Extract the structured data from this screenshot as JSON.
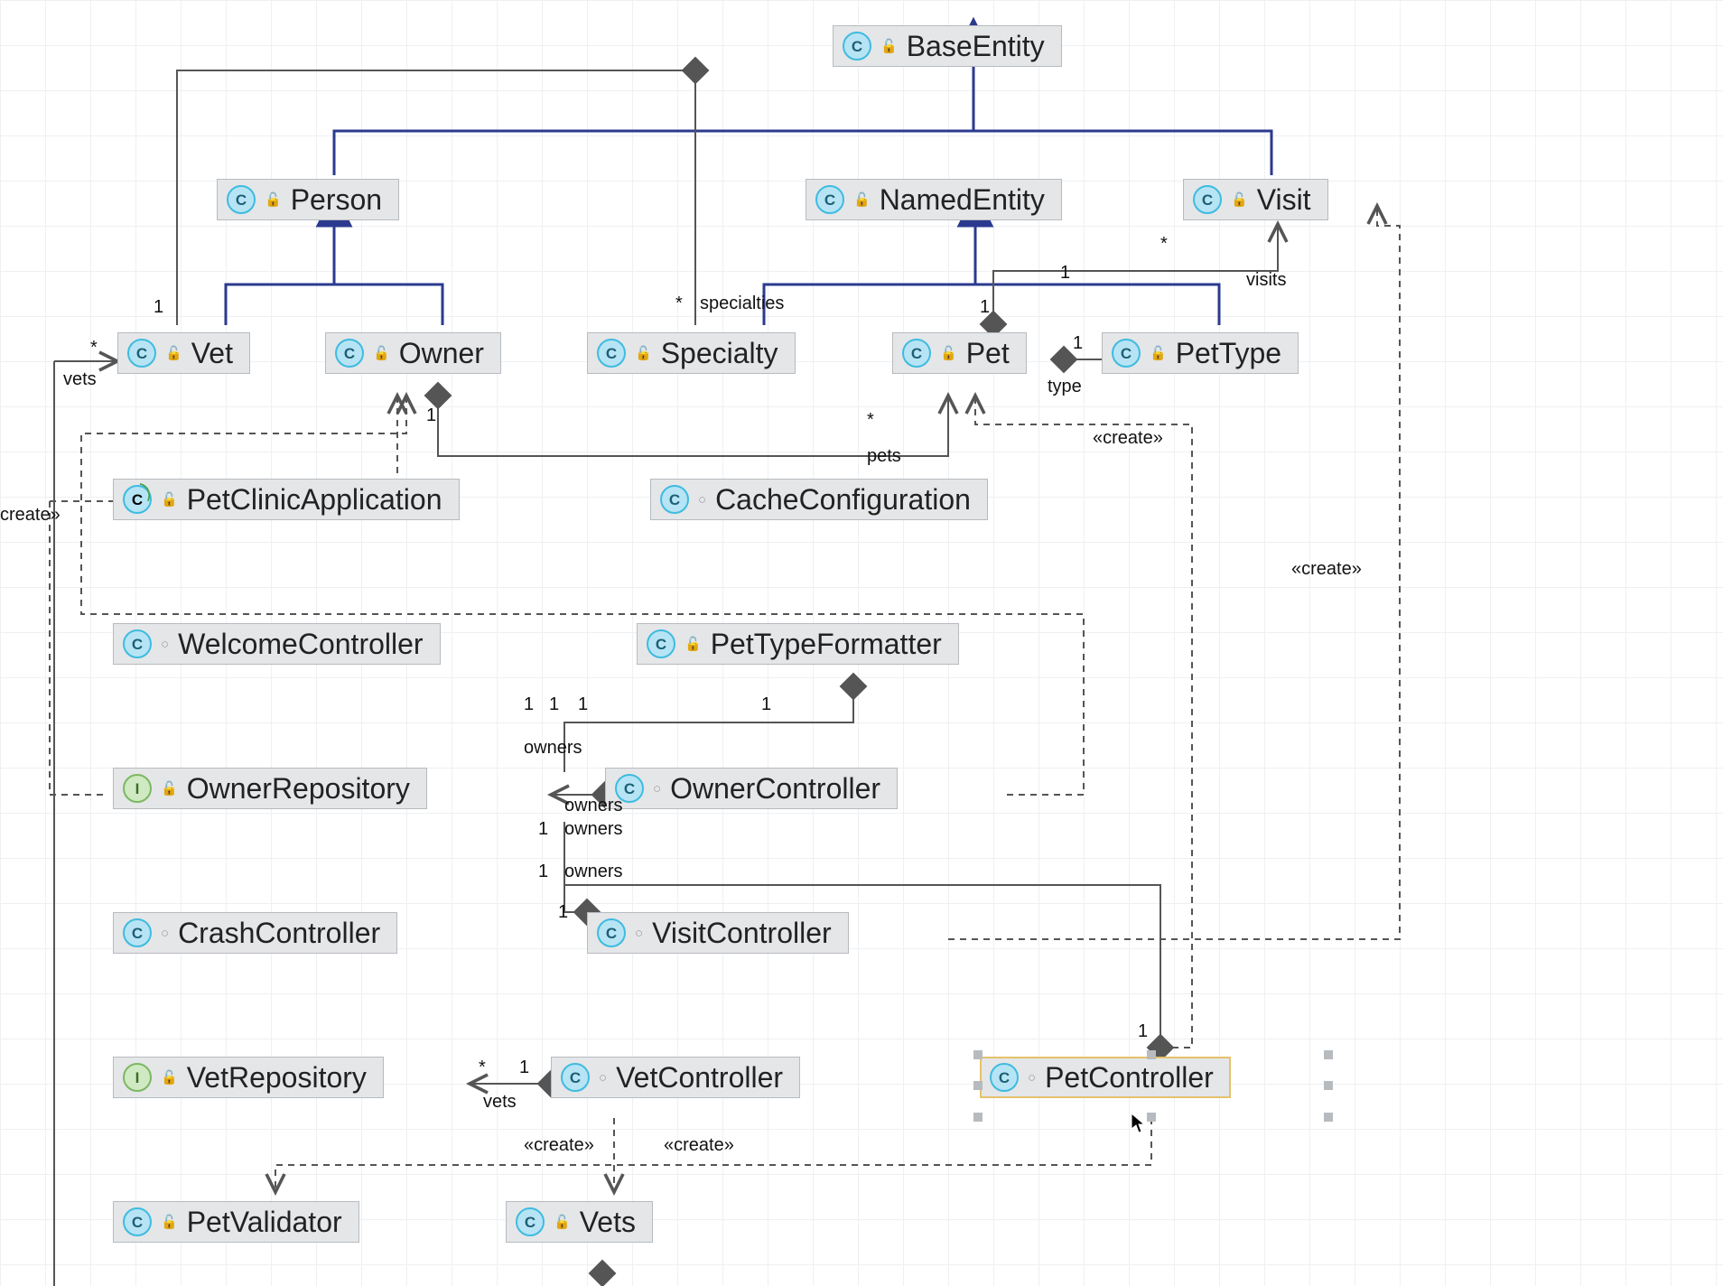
{
  "nodes": {
    "BaseEntity": {
      "icon": "C",
      "vis": "pub",
      "label": "BaseEntity"
    },
    "Person": {
      "icon": "C",
      "vis": "pub",
      "label": "Person"
    },
    "NamedEntity": {
      "icon": "C",
      "vis": "pub",
      "label": "NamedEntity"
    },
    "Visit": {
      "icon": "C",
      "vis": "pub",
      "label": "Visit"
    },
    "Vet": {
      "icon": "C",
      "vis": "pub",
      "label": "Vet"
    },
    "Owner": {
      "icon": "C",
      "vis": "pub",
      "label": "Owner"
    },
    "Specialty": {
      "icon": "C",
      "vis": "pub",
      "label": "Specialty"
    },
    "Pet": {
      "icon": "C",
      "vis": "pub",
      "label": "Pet"
    },
    "PetType": {
      "icon": "C",
      "vis": "pub",
      "label": "PetType"
    },
    "PetClinicApplication": {
      "icon": "Gs",
      "vis": "pub",
      "label": "PetClinicApplication"
    },
    "CacheConfiguration": {
      "icon": "C",
      "vis": "pkg",
      "label": "CacheConfiguration"
    },
    "WelcomeController": {
      "icon": "C",
      "vis": "pkg",
      "label": "WelcomeController"
    },
    "PetTypeFormatter": {
      "icon": "C",
      "vis": "pub",
      "label": "PetTypeFormatter"
    },
    "OwnerRepository": {
      "icon": "I",
      "vis": "pub",
      "label": "OwnerRepository"
    },
    "OwnerController": {
      "icon": "C",
      "vis": "pkg",
      "label": "OwnerController"
    },
    "CrashController": {
      "icon": "C",
      "vis": "pkg",
      "label": "CrashController"
    },
    "VisitController": {
      "icon": "C",
      "vis": "pkg",
      "label": "VisitController"
    },
    "VetRepository": {
      "icon": "I",
      "vis": "pub",
      "label": "VetRepository"
    },
    "VetController": {
      "icon": "C",
      "vis": "pkg",
      "label": "VetController"
    },
    "PetController": {
      "icon": "C",
      "vis": "pkg",
      "label": "PetController"
    },
    "PetValidator": {
      "icon": "C",
      "vis": "pub",
      "label": "PetValidator"
    },
    "Vets": {
      "icon": "C",
      "vis": "pub",
      "label": "Vets"
    }
  },
  "labels": {
    "vets1": "vets",
    "star1": "*",
    "one1": "1",
    "specialties": "specialties",
    "starSpec": "*",
    "oneSpec": "1",
    "pets": "pets",
    "starPets": "*",
    "onePets": "1",
    "type": "type",
    "oneType": "1",
    "visits": "visits",
    "starVisits": "*",
    "oneVisits": "1",
    "create1": "create»",
    "create2": "«create»",
    "create3": "«create»",
    "create4": "«create»",
    "create5": "«create»",
    "owners1": "owners",
    "owners1n": "1",
    "owners2": "owners",
    "owners2n": "1",
    "owners3": "owners",
    "owners3n": "1",
    "ownRep1": "1",
    "ownRep2": "1",
    "ownRep3": "1",
    "petCtrlOne": "1",
    "vets2": "vets",
    "vetRepStar": "*",
    "vetRep1": "1",
    "vetCtrl1": "1"
  }
}
